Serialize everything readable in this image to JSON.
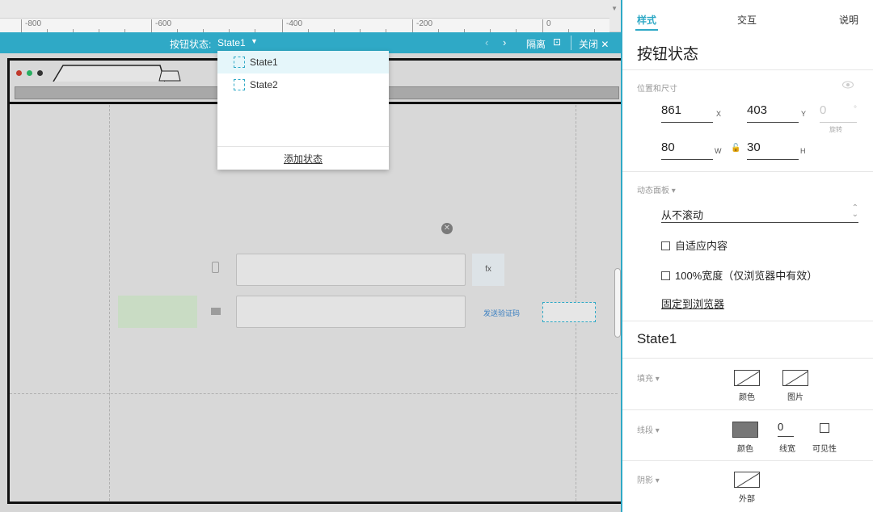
{
  "ruler": {
    "labels": [
      "-800",
      "-600",
      "-400",
      "-200",
      "0"
    ]
  },
  "state_bar": {
    "label": "按钮状态:",
    "current_state": "State1",
    "isolate_label": "隔离",
    "close_label": "关闭"
  },
  "dropdown": {
    "items": [
      {
        "label": "State1",
        "active": true
      },
      {
        "label": "State2",
        "active": false
      }
    ],
    "add_label": "添加状态"
  },
  "canvas": {
    "fx_label": "fx",
    "send_code_label": "发送验证码"
  },
  "panel": {
    "tabs": {
      "style": "样式",
      "interaction": "交互",
      "notes": "说明"
    },
    "title": "按钮状态",
    "position_section": {
      "label": "位置和尺寸",
      "x": "861",
      "x_unit": "X",
      "y": "403",
      "y_unit": "Y",
      "rotation": "0",
      "rotation_unit": "°",
      "rotation_label": "旋转",
      "w": "80",
      "w_unit": "W",
      "h": "30",
      "h_unit": "H"
    },
    "dynamic_panel": {
      "label": "动态面板",
      "scroll_option": "从不滚动",
      "fit_content": "自适应内容",
      "full_width": "100%宽度（仅浏览器中有效）",
      "pin_to_browser": "固定到浏览器"
    },
    "state_heading": "State1",
    "fill": {
      "label": "填充",
      "color_label": "颜色",
      "image_label": "图片"
    },
    "stroke": {
      "label": "线段",
      "color_label": "颜色",
      "width_value": "0",
      "width_label": "线宽",
      "visibility_label": "可见性"
    },
    "shadow": {
      "label": "阴影",
      "outer_label": "外部"
    }
  },
  "colors": {
    "accent": "#2fa9c6",
    "canvas_bg": "#d6d6d6",
    "link_blue": "#3a7fc1",
    "stroke_fill": "#777777"
  }
}
